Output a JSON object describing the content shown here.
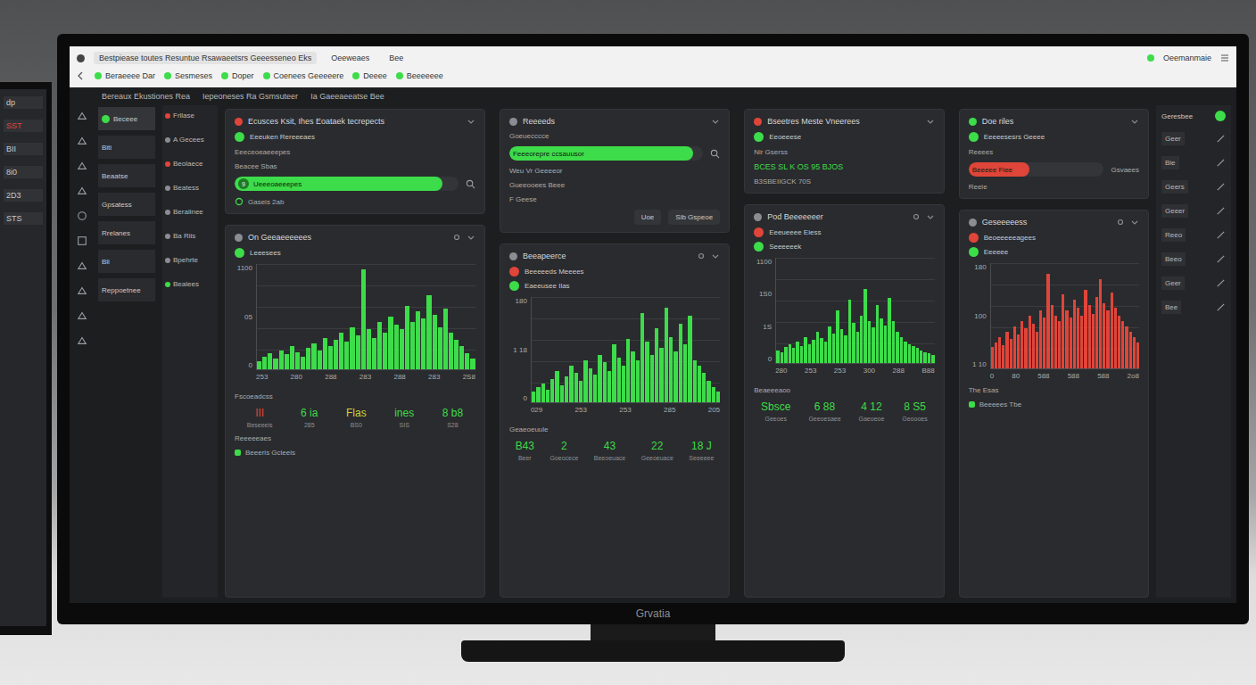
{
  "browser": {
    "tabs": [
      {
        "label": "Bestpiease toutes Resuntue Rsawaeetsrs Geeesseneo Eks",
        "selected": true
      },
      {
        "label": "Oeeweaes",
        "selected": false
      },
      {
        "label": "Bee",
        "selected": false
      }
    ],
    "bookmarks": [
      "Beraeeee Dar",
      "Sesmeses",
      "Doper",
      "Coenees Geeeeere",
      "Deeee",
      "Beeeeeee"
    ],
    "account": "Oeemanmaie"
  },
  "toolbar": [
    "Bereaux Ekustiones Rea",
    "Iepeoneses Ra Gsmsuteer",
    "Ia Gaeeaeeatse Bee"
  ],
  "left_monitor": {
    "items": [
      "dp",
      "SST",
      "BII",
      "8i0",
      "2D3",
      "STS"
    ]
  },
  "sidebar": {
    "items": [
      {
        "label": "Beceee",
        "selected": true
      },
      {
        "label": "Biti",
        "selected": false
      },
      {
        "label": "Beaatse",
        "selected": false
      },
      {
        "label": "Gpsatess",
        "selected": false
      },
      {
        "label": "Rrelanes",
        "selected": false
      },
      {
        "label": "Bli",
        "selected": false
      },
      {
        "label": "Reppoetnee",
        "selected": false
      }
    ]
  },
  "subnav": {
    "items": [
      {
        "label": "Frllase",
        "color": "#e0453a"
      },
      {
        "label": "A Gecees",
        "color": "#8a8d91"
      },
      {
        "label": "Beolaece",
        "color": "#e0453a"
      },
      {
        "label": "Beatess",
        "color": "#8a8d91"
      },
      {
        "label": "Beralinee",
        "color": "#8a8d91"
      },
      {
        "label": "Ba Riis",
        "color": "#8a8d91"
      },
      {
        "label": "Bpehrte",
        "color": "#8a8d91"
      },
      {
        "label": "Bealees",
        "color": "#3ddc4a"
      }
    ]
  },
  "cards": [
    {
      "title": "Ecusces Ksit, Ihes Eoataek tecrepects",
      "dot": "#e0453a",
      "rows": [
        {
          "kind": "item",
          "text": "Eeeuken Rereeeaes",
          "color": "#3ddc4a"
        },
        {
          "kind": "text",
          "text": "Eeeceoeaeeepes"
        },
        {
          "kind": "text",
          "text": "Beacee Sbas"
        },
        {
          "kind": "bar",
          "text": "Ueeeoaeeepes",
          "badge": "9",
          "level": 0.93,
          "color": "#3ddc4a"
        },
        {
          "kind": "footer",
          "text": "Gaseis 2ab"
        }
      ]
    },
    {
      "title": "Reeeeds",
      "dot": "#8a8d91",
      "rows": [
        {
          "kind": "text",
          "text": "Goeuecccce"
        },
        {
          "kind": "bar",
          "text": "Feeeorepre ccsauusor",
          "level": 0.95,
          "color": "#3ddc4a"
        },
        {
          "kind": "text",
          "text": "Weu Vr Geeeeor"
        },
        {
          "kind": "text",
          "text": "Gueeooees Beee"
        },
        {
          "kind": "text",
          "text": "F Geese"
        },
        {
          "kind": "buttons",
          "items": [
            "Uoe",
            "Sib Gspeoe"
          ]
        }
      ]
    },
    {
      "title": "Bseetres Meste Vneerees",
      "dot": "#e0453a",
      "rows": [
        {
          "kind": "item",
          "text": "Eeoeeese",
          "color": "#3ddc4a"
        },
        {
          "kind": "text",
          "text": "Nir Gserss"
        },
        {
          "kind": "value",
          "text": "BCES SL K OS 95 BJOS",
          "color": "#3ddc4a"
        },
        {
          "kind": "text",
          "text": "B3SBEIIGCK 70S"
        }
      ]
    },
    {
      "title": "Doe riles",
      "dot": "#3ddc4a",
      "rows": [
        {
          "kind": "item",
          "text": "Eeeeesesrs Geeee",
          "color": "#3ddc4a"
        },
        {
          "kind": "text",
          "text": "Reeees"
        },
        {
          "kind": "bar",
          "text": "Beeeee Fiee",
          "side": "Gsvaees",
          "level": 0.45,
          "color": "#e0453a"
        },
        {
          "kind": "text",
          "text": "Reeie"
        }
      ]
    }
  ],
  "charts": [
    {
      "title": "On Geeaeeeeees",
      "dot": "#8a8d91",
      "legend": [
        {
          "label": "Leeesees",
          "color": "#3ddc4a"
        }
      ],
      "y_ticks": [
        "1100",
        "05",
        "0"
      ],
      "x_ticks": [
        "253",
        "280",
        "288",
        "283",
        "288",
        "283",
        "2S8"
      ],
      "color": "#3ddc4a",
      "values": [
        8,
        12,
        15,
        10,
        18,
        14,
        22,
        16,
        12,
        20,
        25,
        18,
        30,
        22,
        28,
        35,
        26,
        40,
        32,
        95,
        38,
        30,
        45,
        35,
        50,
        42,
        38,
        60,
        45,
        55,
        48,
        70,
        52,
        40,
        58,
        35,
        28,
        22,
        15,
        10
      ],
      "stats_title": "Fscoeadcss",
      "stats": [
        {
          "value": "III",
          "sub": "Beseeeis",
          "color": "#e0453a"
        },
        {
          "value": "6 ia",
          "sub": "285",
          "color": "#3ddc4a"
        },
        {
          "value": "Flas",
          "sub": "BS0",
          "color": "#c9d63a"
        },
        {
          "value": "ines",
          "sub": "SIS",
          "color": "#3ddc4a"
        },
        {
          "value": "8 b8",
          "sub": "S28",
          "color": "#3ddc4a"
        }
      ],
      "footer": [
        "Reeeeeaes",
        "Beeeris Gcleeis"
      ]
    },
    {
      "title": "Beeapeerce",
      "dot": "#8a8d91",
      "legend": [
        {
          "label": "Beeeeeds Meeees",
          "color": "#e0453a"
        },
        {
          "label": "Eaeeusee Ilas",
          "color": "#3ddc4a"
        }
      ],
      "y_ticks": [
        "180",
        "1 18",
        "0"
      ],
      "x_ticks": [
        "029",
        "253",
        "253",
        "285",
        "205"
      ],
      "color": "#3ddc4a",
      "values": [
        10,
        14,
        18,
        12,
        22,
        30,
        16,
        25,
        35,
        28,
        20,
        40,
        32,
        26,
        45,
        38,
        30,
        55,
        42,
        35,
        60,
        48,
        40,
        85,
        58,
        45,
        70,
        52,
        90,
        62,
        48,
        75,
        55,
        82,
        40,
        35,
        28,
        20,
        14,
        10
      ],
      "stats_title": "Geaeoeuule",
      "stats": [
        {
          "value": "B43",
          "sub": "Beer",
          "color": "#3ddc4a"
        },
        {
          "value": "2",
          "sub": "Goeocece",
          "color": "#3ddc4a"
        },
        {
          "value": "43",
          "sub": "Beeoeuace",
          "color": "#3ddc4a"
        },
        {
          "value": "22",
          "sub": "Geeoeuace",
          "color": "#3ddc4a"
        },
        {
          "value": "18 J",
          "sub": "Seeeeee",
          "color": "#3ddc4a"
        }
      ],
      "footer": []
    },
    {
      "title": "Pod Beeeeeeer",
      "dot": "#8a8d91",
      "legend": [
        {
          "label": "Eeeueeee Eiess",
          "color": "#e0453a"
        },
        {
          "label": "Seeeeeek",
          "color": "#3ddc4a"
        }
      ],
      "y_ticks": [
        "1100",
        "1S0",
        "1S",
        "0"
      ],
      "x_ticks": [
        "280",
        "253",
        "253",
        "300",
        "288",
        "B88"
      ],
      "color": "#3ddc4a",
      "values": [
        12,
        10,
        15,
        18,
        14,
        20,
        16,
        25,
        18,
        22,
        30,
        24,
        20,
        35,
        28,
        50,
        32,
        26,
        60,
        38,
        30,
        45,
        70,
        40,
        34,
        55,
        42,
        36,
        62,
        40,
        30,
        25,
        20,
        18,
        16,
        14,
        12,
        10,
        9,
        8
      ],
      "stats_title": "Beaeeeaoo",
      "stats": [
        {
          "value": "Sbsce",
          "sub": "Geeoes",
          "color": "#3ddc4a"
        },
        {
          "value": "6 88",
          "sub": "Geeoesaee",
          "color": "#3ddc4a"
        },
        {
          "value": "4 12",
          "sub": "Gaeoeoe",
          "color": "#3ddc4a"
        },
        {
          "value": "8 S5",
          "sub": "Geoooes",
          "color": "#3ddc4a"
        }
      ],
      "footer": []
    },
    {
      "title": "Geseeeeess",
      "dot": "#8a8d91",
      "legend": [
        {
          "label": "Beoeeeeeagees",
          "color": "#e0453a"
        },
        {
          "label": "Eeeeee",
          "color": "#3ddc4a"
        }
      ],
      "y_ticks": [
        "180",
        "100",
        "1 10"
      ],
      "x_ticks": [
        "0",
        "80",
        "588",
        "588",
        "588",
        "2o8"
      ],
      "color": "#e0453a",
      "values": [
        20,
        25,
        30,
        22,
        35,
        28,
        40,
        32,
        45,
        38,
        50,
        42,
        35,
        55,
        48,
        90,
        60,
        50,
        45,
        70,
        55,
        48,
        65,
        58,
        50,
        75,
        60,
        52,
        68,
        85,
        62,
        55,
        72,
        58,
        50,
        45,
        40,
        35,
        30,
        25
      ],
      "stats_title": "",
      "stats": [],
      "footer": [
        "The Esas",
        "Beeeees Tbe"
      ]
    }
  ],
  "right_rail": {
    "title": "Geresbee",
    "items": [
      "Geer",
      "Bie",
      "Geers",
      "Geeer",
      "Reeo",
      "Beeo",
      "Geer",
      "Bee"
    ]
  },
  "brand": "Grvatia"
}
